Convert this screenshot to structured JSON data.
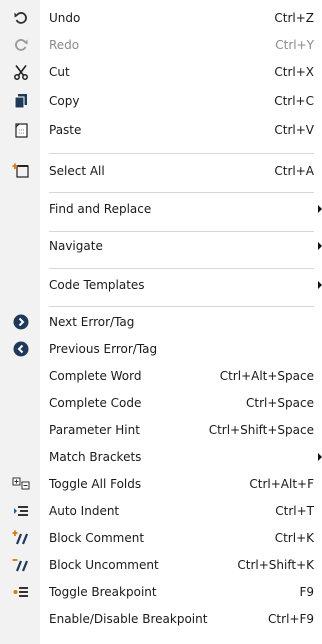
{
  "menu": {
    "items": [
      {
        "label": "Undo",
        "shortcut": "Ctrl+Z",
        "icon": "undo-icon"
      },
      {
        "label": "Redo",
        "shortcut": "Ctrl+Y",
        "icon": "redo-icon",
        "disabled": true
      },
      {
        "label": "Cut",
        "shortcut": "Ctrl+X",
        "icon": "scissors-icon"
      },
      {
        "label": "Copy",
        "shortcut": "Ctrl+C",
        "icon": "copy-icon"
      },
      {
        "label": "Paste",
        "shortcut": "Ctrl+V",
        "icon": "paste-icon"
      },
      {
        "label": "Select All",
        "shortcut": "Ctrl+A",
        "icon": "select-all-icon"
      },
      {
        "label": "Find and Replace",
        "submenu": true
      },
      {
        "label": "Navigate",
        "submenu": true
      },
      {
        "label": "Code Templates",
        "submenu": true
      },
      {
        "label": "Next Error/Tag",
        "icon": "next-arrow-icon"
      },
      {
        "label": "Previous Error/Tag",
        "icon": "previous-arrow-icon"
      },
      {
        "label": "Complete Word",
        "shortcut": "Ctrl+Alt+Space"
      },
      {
        "label": "Complete Code",
        "shortcut": "Ctrl+Space"
      },
      {
        "label": "Parameter Hint",
        "shortcut": "Ctrl+Shift+Space"
      },
      {
        "label": "Match Brackets",
        "submenu": true
      },
      {
        "label": "Toggle All Folds",
        "shortcut": "Ctrl+Alt+F",
        "icon": "toggle-folds-icon"
      },
      {
        "label": "Auto Indent",
        "shortcut": "Ctrl+T",
        "icon": "auto-indent-icon"
      },
      {
        "label": "Block Comment",
        "shortcut": "Ctrl+K",
        "icon": "block-comment-icon"
      },
      {
        "label": "Block Uncomment",
        "shortcut": "Ctrl+Shift+K",
        "icon": "block-uncomment-icon"
      },
      {
        "label": "Toggle Breakpoint",
        "shortcut": "F9",
        "icon": "breakpoint-icon"
      },
      {
        "label": "Enable/Disable Breakpoint",
        "shortcut": "Ctrl+F9"
      }
    ]
  },
  "colors": {
    "gutter": "#f2f2f2",
    "separator": "#d6d6d6",
    "disabled_text": "#8a8a8a",
    "icon_dark": "#333333",
    "icon_navy": "#1d3a5a",
    "icon_orange": "#e07a00",
    "icon_blue": "#1b5fb0"
  }
}
